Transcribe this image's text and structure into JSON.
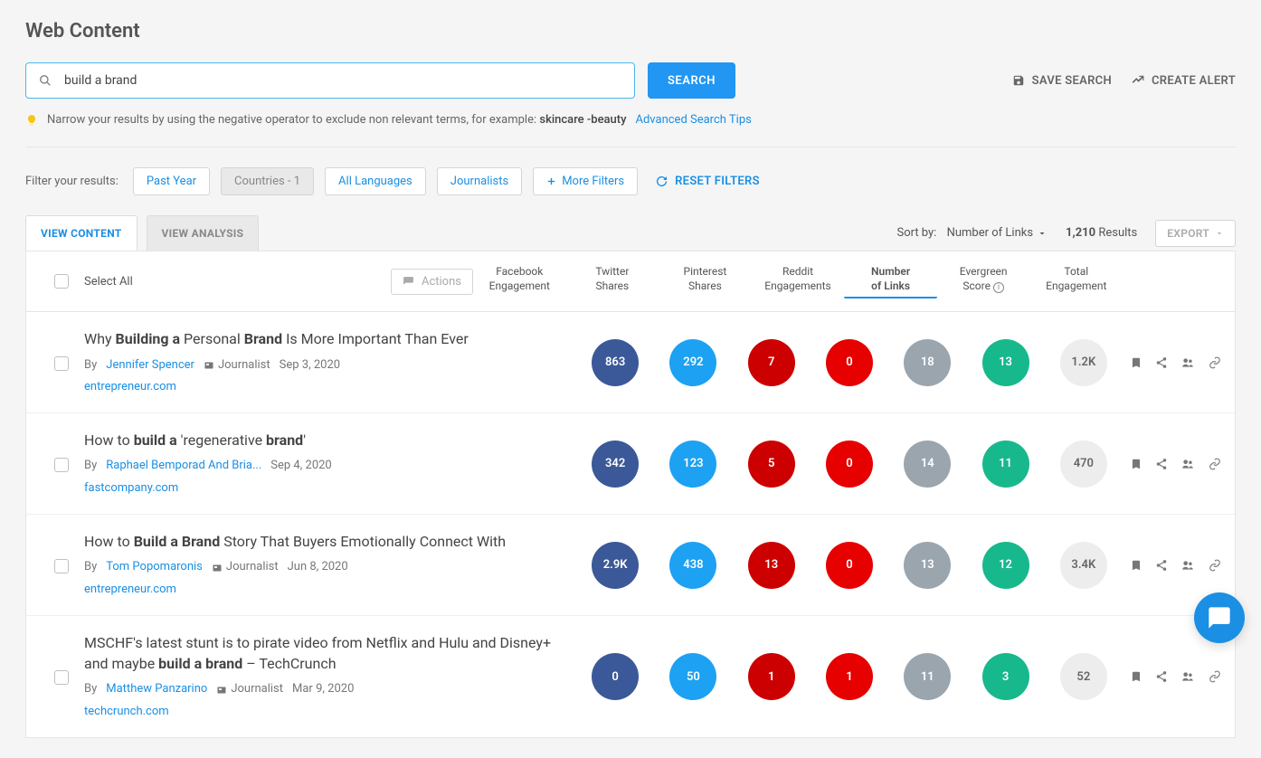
{
  "page_title": "Web Content",
  "search": {
    "value": "build a brand",
    "button": "SEARCH"
  },
  "top_actions": {
    "save": "SAVE SEARCH",
    "alert": "CREATE ALERT"
  },
  "tip": {
    "text_before": "Narrow your results by using the negative operator to exclude non relevant terms, for example: ",
    "example": "skincare -beauty",
    "link": "Advanced Search Tips"
  },
  "filters": {
    "label": "Filter your results:",
    "past_year": "Past Year",
    "countries": "Countries - 1",
    "languages": "All Languages",
    "journalists": "Journalists",
    "more": "More Filters",
    "reset": "RESET FILTERS"
  },
  "tabs": {
    "content": "VIEW CONTENT",
    "analysis": "VIEW ANALYSIS"
  },
  "sort": {
    "prefix": "Sort by:",
    "value": "Number of Links"
  },
  "results": {
    "count": "1,210",
    "label": "Results"
  },
  "export": "EXPORT",
  "thead": {
    "select_all": "Select All",
    "actions": "Actions",
    "fb1": "Facebook",
    "fb2": "Engagement",
    "tw1": "Twitter",
    "tw2": "Shares",
    "pin1": "Pinterest",
    "pin2": "Shares",
    "red1": "Reddit",
    "red2": "Engagements",
    "lnk1": "Number",
    "lnk2": "of Links",
    "ever1": "Evergreen",
    "ever2": "Score",
    "tot1": "Total",
    "tot2": "Engagement"
  },
  "rows": [
    {
      "title_pre": "Why ",
      "title_b1": "Building a",
      "title_mid": " Personal ",
      "title_b2": "Brand",
      "title_post": " Is More Important Than Ever",
      "by": "By",
      "author": "Jennifer Spencer",
      "role": "Journalist",
      "date": "Sep 3, 2020",
      "domain": "entrepreneur.com",
      "fb": "863",
      "tw": "292",
      "pin": "7",
      "red": "0",
      "links": "18",
      "ever": "13",
      "total": "1.2K"
    },
    {
      "title_pre": "How to ",
      "title_b1": "build a",
      "title_mid": " 'regenerative ",
      "title_b2": "brand",
      "title_post": "'",
      "by": "By",
      "author": "Raphael Bemporad And Bria...",
      "role": "",
      "date": "Sep 4, 2020",
      "domain": "fastcompany.com",
      "fb": "342",
      "tw": "123",
      "pin": "5",
      "red": "0",
      "links": "14",
      "ever": "11",
      "total": "470"
    },
    {
      "title_pre": "How to ",
      "title_b1": "Build a Brand",
      "title_mid": " Story That Buyers Emotionally Connect With",
      "title_b2": "",
      "title_post": "",
      "by": "By",
      "author": "Tom Popomaronis",
      "role": "Journalist",
      "date": "Jun 8, 2020",
      "domain": "entrepreneur.com",
      "fb": "2.9K",
      "tw": "438",
      "pin": "13",
      "red": "0",
      "links": "13",
      "ever": "12",
      "total": "3.4K"
    },
    {
      "title_pre": "MSCHF's latest stunt is to pirate video from Netflix and Hulu and Disney+ and maybe ",
      "title_b1": "build a brand",
      "title_mid": " – TechCrunch",
      "title_b2": "",
      "title_post": "",
      "by": "By",
      "author": "Matthew Panzarino",
      "role": "Journalist",
      "date": "Mar 9, 2020",
      "domain": "techcrunch.com",
      "fb": "0",
      "tw": "50",
      "pin": "1",
      "red": "1",
      "links": "11",
      "ever": "3",
      "total": "52"
    }
  ]
}
